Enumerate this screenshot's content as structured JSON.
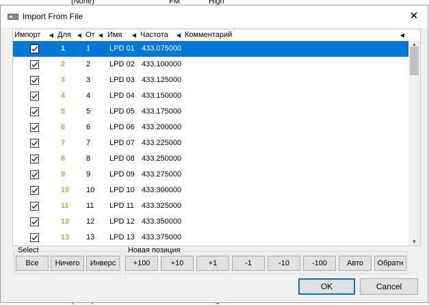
{
  "background": {
    "top": {
      "c1": "(None)",
      "c2": "FM",
      "c3": "High"
    },
    "bottom": {
      "c1": "(None)",
      "c2": "FM",
      "c3": "High"
    }
  },
  "dialog": {
    "title": "Import From File",
    "close_glyph": "✕",
    "icon_name": "app-window-icon"
  },
  "table": {
    "columns": [
      "Импорт",
      "Для",
      "От",
      "Имя",
      "Частота",
      "Комментарий"
    ],
    "rows": [
      {
        "import": true,
        "dest": "1",
        "src": "1",
        "name": "LPD 01",
        "freq": "433.075000",
        "comment": ""
      },
      {
        "import": true,
        "dest": "2",
        "src": "2",
        "name": "LPD 02",
        "freq": "433.100000",
        "comment": ""
      },
      {
        "import": true,
        "dest": "3",
        "src": "3",
        "name": "LPD 03",
        "freq": "433.125000",
        "comment": ""
      },
      {
        "import": true,
        "dest": "4",
        "src": "4",
        "name": "LPD 04",
        "freq": "433.150000",
        "comment": ""
      },
      {
        "import": true,
        "dest": "5",
        "src": "5",
        "name": "LPD 05",
        "freq": "433.175000",
        "comment": ""
      },
      {
        "import": true,
        "dest": "6",
        "src": "6",
        "name": "LPD 06",
        "freq": "433.200000",
        "comment": ""
      },
      {
        "import": true,
        "dest": "7",
        "src": "7",
        "name": "LPD 07",
        "freq": "433.225000",
        "comment": ""
      },
      {
        "import": true,
        "dest": "8",
        "src": "8",
        "name": "LPD 08",
        "freq": "433.250000",
        "comment": ""
      },
      {
        "import": true,
        "dest": "9",
        "src": "9",
        "name": "LPD 09",
        "freq": "433.275000",
        "comment": ""
      },
      {
        "import": true,
        "dest": "10",
        "src": "10",
        "name": "LPD 10",
        "freq": "433.300000",
        "comment": ""
      },
      {
        "import": true,
        "dest": "11",
        "src": "11",
        "name": "LPD 11",
        "freq": "433.325000",
        "comment": ""
      },
      {
        "import": true,
        "dest": "12",
        "src": "12",
        "name": "LPD 12",
        "freq": "433.350000",
        "comment": ""
      },
      {
        "import": true,
        "dest": "13",
        "src": "13",
        "name": "LPD 13",
        "freq": "433.375000",
        "comment": ""
      }
    ],
    "selected_row": 0
  },
  "select_group": {
    "label": "Select",
    "buttons": [
      "Все",
      "Ничего",
      "Инверс"
    ]
  },
  "position_group": {
    "label": "Новая позиция",
    "buttons": [
      "+100",
      "+10",
      "+1",
      "-1",
      "-10",
      "-100",
      "Авто",
      "Обратн"
    ]
  },
  "footer": {
    "ok_label": "OK",
    "cancel_label": "Cancel"
  },
  "colors": {
    "selection": "#0078d7",
    "dest_number": "#e0a030"
  }
}
